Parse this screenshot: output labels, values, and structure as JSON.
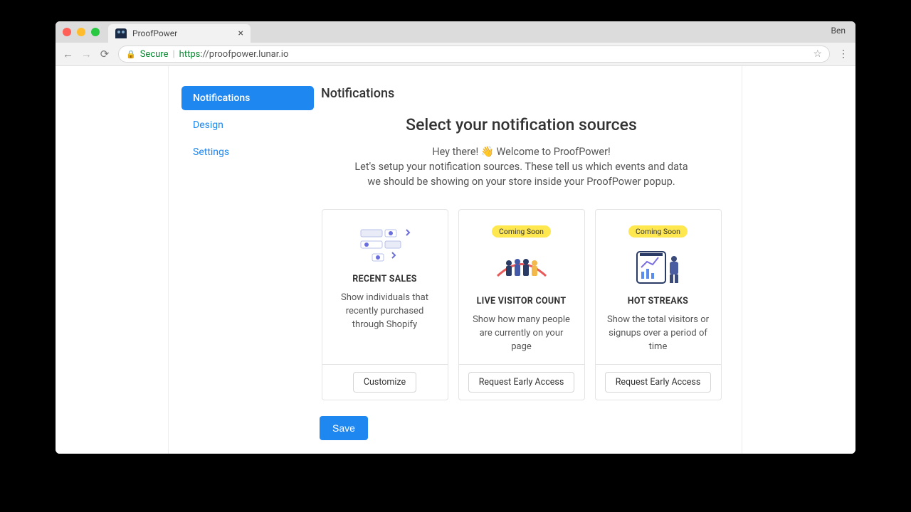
{
  "browser": {
    "tab_title": "ProofPower",
    "user_label": "Ben",
    "secure_label": "Secure",
    "url_scheme": "https",
    "url_rest": "://proofpower.lunar.io"
  },
  "sidebar": {
    "items": [
      {
        "label": "Notifications",
        "active": true
      },
      {
        "label": "Design",
        "active": false
      },
      {
        "label": "Settings",
        "active": false
      }
    ]
  },
  "page": {
    "heading": "Notifications",
    "hero_title": "Select your notification sources",
    "hero_sub": "Hey there! 👋  Welcome to ProofPower!\nLet's setup your notification sources. These tell us which events and data we should be showing on your store inside your ProofPower popup."
  },
  "cards": [
    {
      "badge": null,
      "title": "RECENT SALES",
      "desc": "Show individuals that recently purchased through Shopify",
      "button": "Customize"
    },
    {
      "badge": "Coming Soon",
      "title": "LIVE VISITOR COUNT",
      "desc": "Show how many people are currently on your page",
      "button": "Request Early Access"
    },
    {
      "badge": "Coming Soon",
      "title": "HOT STREAKS",
      "desc": "Show the total visitors or signups over a period of time",
      "button": "Request Early Access"
    }
  ],
  "actions": {
    "save": "Save"
  }
}
